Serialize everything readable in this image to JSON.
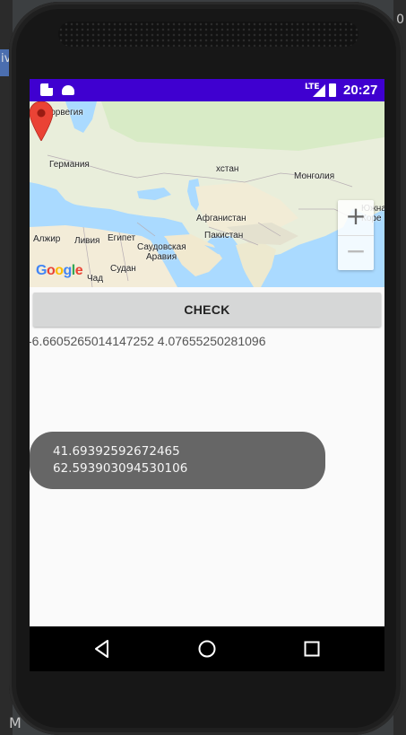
{
  "ide": {
    "left_text": "iv",
    "right_text": "0",
    "bottom_text": "M"
  },
  "statusbar": {
    "network_label": "LTE",
    "time": "20:27",
    "color": "#3f00d0",
    "icons": [
      "sd-card-icon",
      "android-icon",
      "signal-icon",
      "battery-icon"
    ]
  },
  "map": {
    "labels": {
      "norway": "Норвегия",
      "germany": "Германия",
      "kazakhstan": "хстан",
      "mongolia": "Монголия",
      "afghanistan": "Афганистан",
      "pakistan": "Пакистан",
      "south_korea_1": "Южна",
      "south_korea_2": "Коре",
      "algeria": "Алжир",
      "libya": "Ливия",
      "egypt": "Египет",
      "saudi_1": "Саудовская",
      "saudi_2": "Аравия",
      "sudan": "Судан",
      "chad": "Чад"
    },
    "logo": "Google",
    "zoom_in_symbol": "+",
    "zoom_out_symbol": "−",
    "marker_color": "#ea4335"
  },
  "main": {
    "check_button_label": "CHECK",
    "coords_text": "-6.6605265014147252 4.07655250281096"
  },
  "toast": {
    "line1": "41.69392592672465",
    "line2": "62.593903094530106"
  },
  "navbar": {
    "back": "back-icon",
    "home": "home-icon",
    "recent": "recent-apps-icon"
  }
}
